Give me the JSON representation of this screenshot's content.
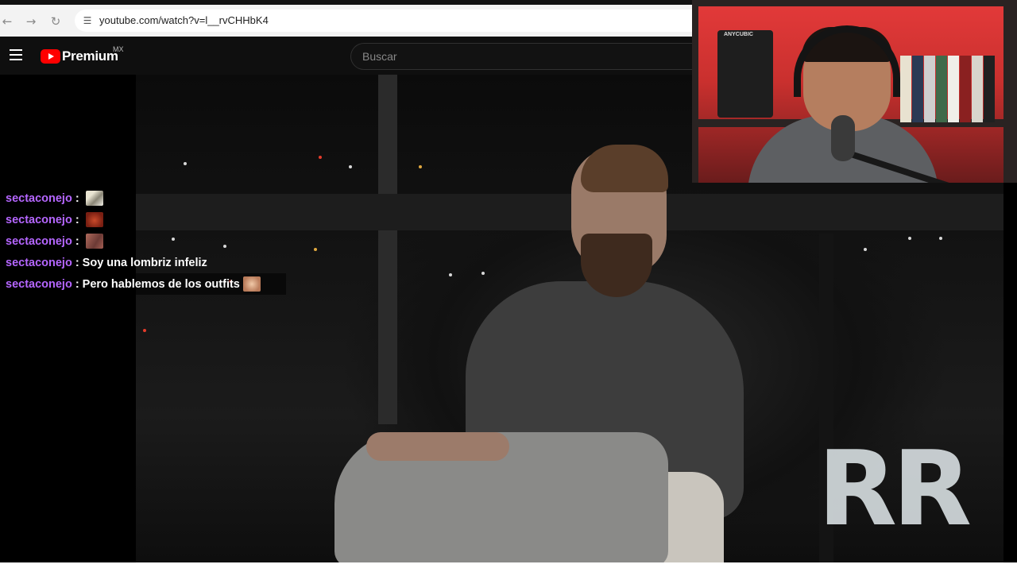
{
  "browser": {
    "back_icon": "arrow-left-icon",
    "forward_icon": "arrow-right-icon",
    "reload_icon": "reload-icon",
    "site_info_icon": "tune-icon",
    "url": "youtube.com/watch?v=l__rvCHHbK4"
  },
  "youtube": {
    "logo_text": "Premium",
    "region": "MX",
    "search_placeholder": "Buscar",
    "brand_color": "#ff0000"
  },
  "chat": {
    "messages": [
      {
        "user": "sectaconejo",
        "sep": ":",
        "text": "",
        "emote": "emote-paper"
      },
      {
        "user": "sectaconejo",
        "sep": ":",
        "text": "",
        "emote": "emote-red-face"
      },
      {
        "user": "sectaconejo",
        "sep": ":",
        "text": "",
        "emote": "emote-face"
      },
      {
        "user": "sectaconejo",
        "sep": ":",
        "text": "Soy una lombriz infeliz",
        "emote": ""
      },
      {
        "user": "sectaconejo",
        "sep": ":",
        "text": "Pero hablemos de los outfits",
        "emote": "emote-face-closeup"
      }
    ],
    "username_color": "#b566ff"
  },
  "video": {
    "background_sign_text": "RR"
  },
  "facecam": {
    "printer_brand": "ANYCUBIC"
  }
}
